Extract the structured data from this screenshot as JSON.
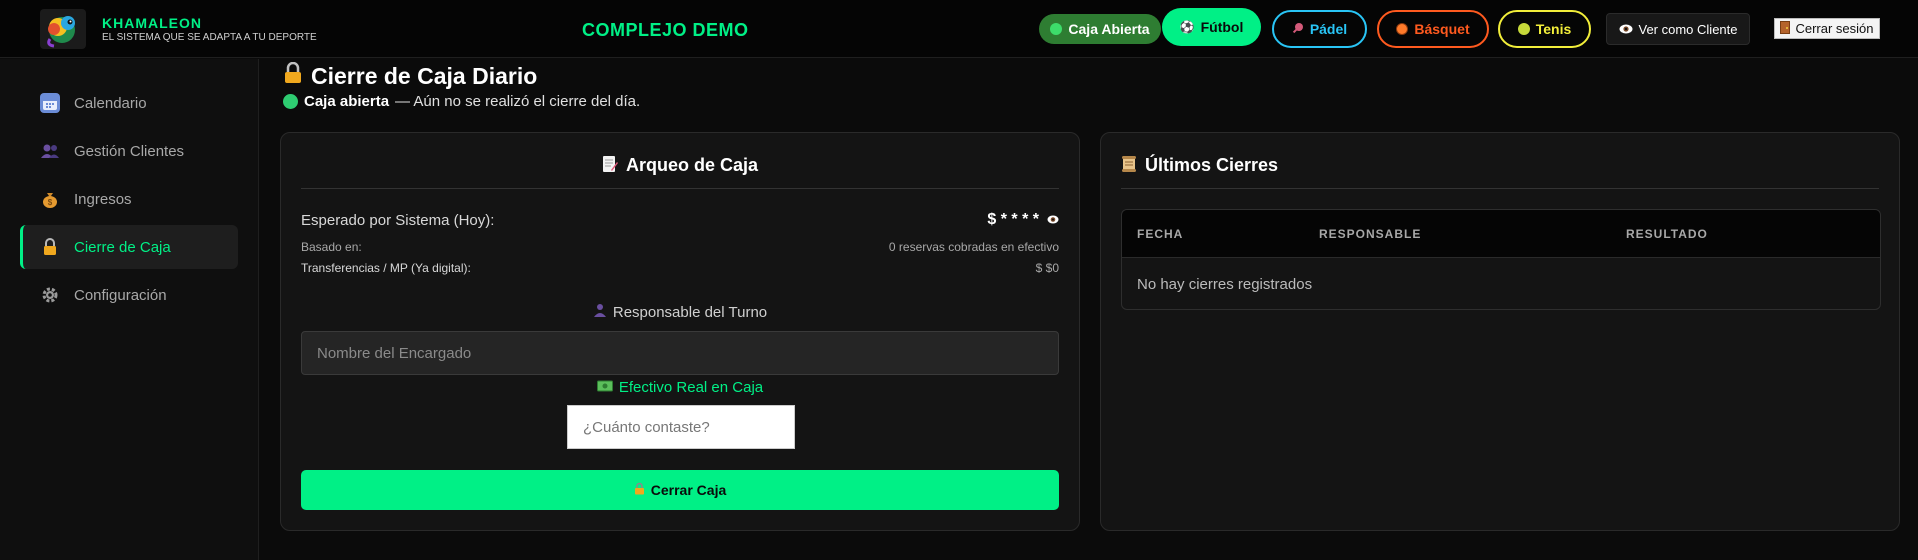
{
  "header": {
    "brand_name": "KHAMALEON",
    "brand_tagline": "EL SISTEMA QUE SE ADAPTA A TU DEPORTE",
    "club_name": "COMPLEJO DEMO",
    "status_pill": "Caja Abierta",
    "sports": [
      {
        "label": "Fútbol",
        "color": "#00f086",
        "icon": "soccer-ball-icon"
      },
      {
        "label": "Pádel",
        "color": "#29c5f6",
        "icon": "paddle-icon"
      },
      {
        "label": "Básquet",
        "color": "#ff5a1f",
        "icon": "basketball-icon"
      },
      {
        "label": "Tenis",
        "color": "#f2ee3a",
        "icon": "tennis-ball-icon"
      }
    ],
    "view_client_label": "Ver como Cliente",
    "logout_label": "Cerrar sesión"
  },
  "sidebar": {
    "items": [
      {
        "label": "Calendario",
        "icon": "calendar-icon",
        "active": false
      },
      {
        "label": "Gestión Clientes",
        "icon": "users-icon",
        "active": false
      },
      {
        "label": "Ingresos",
        "icon": "money-bag-icon",
        "active": false
      },
      {
        "label": "Cierre de Caja",
        "icon": "lock-icon",
        "active": true
      },
      {
        "label": "Configuración",
        "icon": "gear-icon",
        "active": false
      }
    ]
  },
  "page": {
    "title": "Cierre de Caja Diario",
    "status_bold": "Caja abierta",
    "status_rest": "— Aún no se realizó el cierre del día."
  },
  "arqueo": {
    "title": "Arqueo de Caja",
    "expected_label": "Esperado por Sistema (Hoy):",
    "expected_value": "$ * * * *",
    "based_label": "Basado en:",
    "based_value": "0 reservas cobradas en efectivo",
    "transfer_label": "Transferencias / MP (Ya digital):",
    "transfer_value": "$ $0",
    "responsible_label": "Responsable del Turno",
    "responsible_placeholder": "Nombre del Encargado",
    "cash_label": "Efectivo Real en Caja",
    "cash_placeholder": "¿Cuánto contaste?",
    "close_button": "Cerrar Caja"
  },
  "closures": {
    "title": "Últimos Cierres",
    "columns": [
      "FECHA",
      "RESPONSABLE",
      "RESULTADO"
    ],
    "empty_message": "No hay cierres registrados"
  },
  "colors": {
    "accent": "#00f086",
    "status_open": "#2e7d32"
  }
}
